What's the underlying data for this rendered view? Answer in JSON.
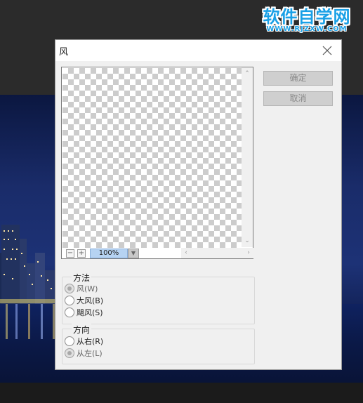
{
  "watermark": {
    "title": "软件自学网",
    "url": "WWW.RJZXW.COM"
  },
  "dialog": {
    "title": "风",
    "close_icon": "close-icon",
    "ok_label": "确定",
    "cancel_label": "取消"
  },
  "preview": {
    "zoom_out_label": "−",
    "zoom_in_label": "+",
    "zoom_value": "100%",
    "zoom_drop_icon": "chevron-down-icon",
    "scroll_up_icon": "chevron-up-icon",
    "scroll_down_icon": "chevron-down-icon",
    "scroll_left_icon": "chevron-left-icon",
    "scroll_right_icon": "chevron-right-icon"
  },
  "method": {
    "label": "方法",
    "options": [
      {
        "label": "风(W)",
        "checked": true
      },
      {
        "label": "大风(B)",
        "checked": false
      },
      {
        "label": "飓风(S)",
        "checked": false
      }
    ]
  },
  "direction": {
    "label": "方向",
    "options": [
      {
        "label": "从右(R)",
        "checked": false
      },
      {
        "label": "从左(L)",
        "checked": true
      }
    ]
  },
  "colors": {
    "dialog_bg": "#f0f0f0",
    "zoom_field_bg": "#b6d3f2",
    "logo_blue": "#1aa0e6"
  }
}
